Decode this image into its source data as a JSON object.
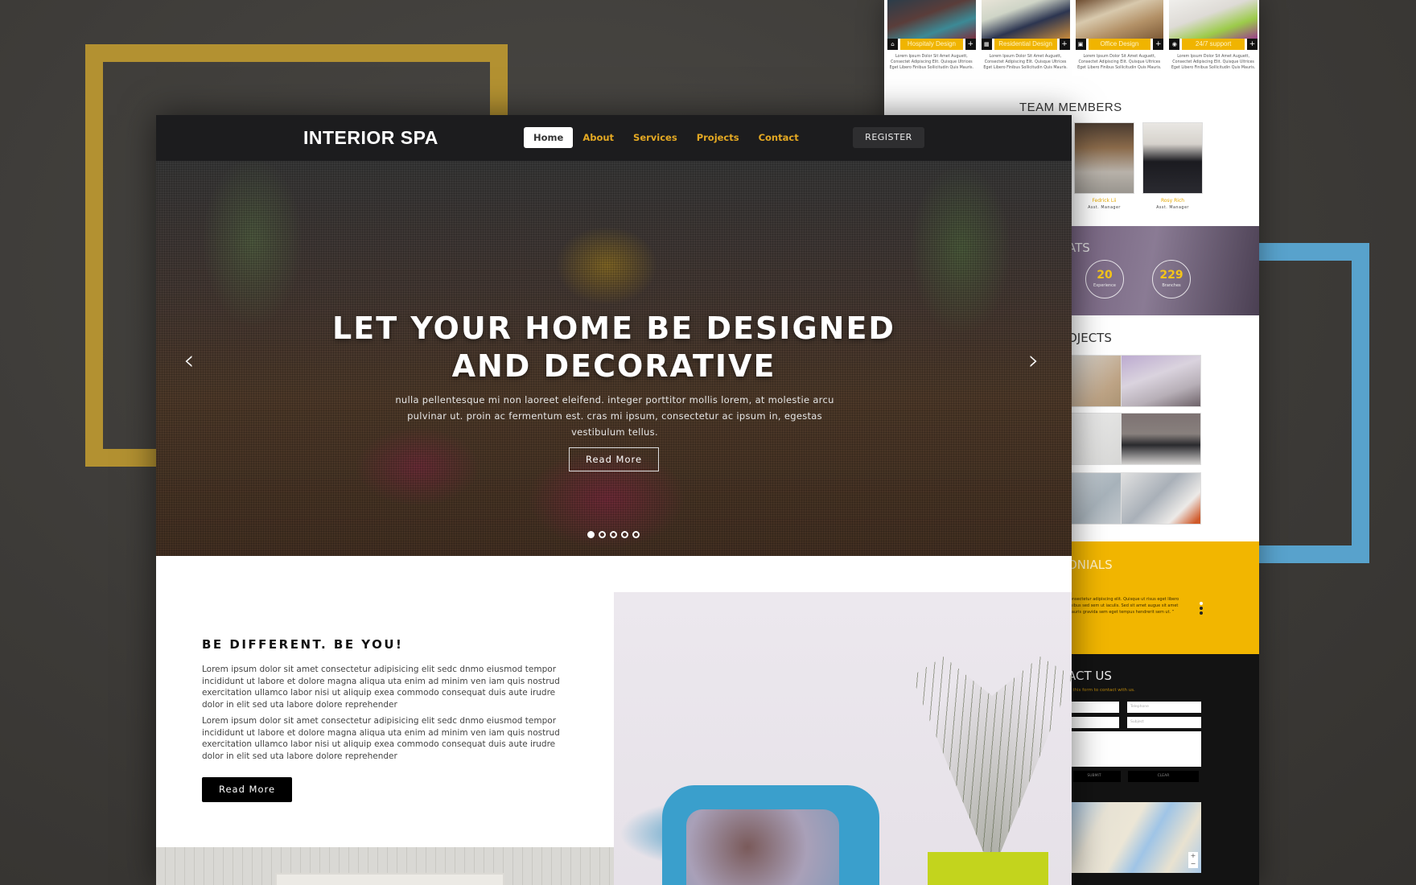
{
  "preview": {
    "services": [
      {
        "icon": "home-icon",
        "label": "Hospitaly Design",
        "text": "Lorem Ipsum Dolor Sit Amet Auguett, Consectet Adipiscing Elit. Quisque Ultrices Eget Libero Finibus Sollicitudin Quis Mauris."
      },
      {
        "icon": "building-icon",
        "label": "Residential Design",
        "text": "Lorem Ipsum Dolor Sit Amet Auguett, Consectet Adipiscing Elit. Quisque Ultrices Eget Libero Finibus Sollicitudin Quis Mauris."
      },
      {
        "icon": "office-icon",
        "label": "Office Design",
        "text": "Lorem Ipsum Dolor Sit Amet Auguett, Consectet Adipiscing Elit. Quisque Ultrices Eget Libero Finibus Sollicitudin Quis Mauris."
      },
      {
        "icon": "support-icon",
        "label": "24/7 support",
        "text": "Lorem Ipsum Dolor Sit Amet Auguett, Consectet Adipiscing Elit. Quisque Ultrices Eget Libero Finibus Sollicitudin Quis Mauris."
      }
    ],
    "plus": "+",
    "team_title": "TEAM MEMBERS",
    "team": [
      {
        "name": "Fedrick Lii",
        "role": "Asst. Manager"
      },
      {
        "name": "Rosy Rich",
        "role": "Asst. Manager"
      }
    ],
    "stats_title": "ATS",
    "stats": [
      {
        "value": "20",
        "label": "Experience"
      },
      {
        "value": "229",
        "label": "Branches"
      }
    ],
    "projects_title": "OJECTS",
    "testimonials_title": "ONIALS",
    "testimonial_text": "consectetur adipiscing elit. Quisque ut risus eget libero finibus sed sem ut iaculis. Sed sit amet augue sit amet mauris gravida sem eget tempus hendrerit sem ut. ”",
    "contact_title": "ACT US",
    "contact_sub": "ill this form to contact with us.",
    "contact_fields": [
      "",
      "Telephone",
      "",
      "Subject",
      ""
    ],
    "submit": "SUBMIT",
    "clear": "CLEAR",
    "map_zoom_in": "+",
    "map_zoom_out": "−"
  },
  "nav": {
    "brand": "INTERIOR SPA",
    "links": [
      "Home",
      "About",
      "Services",
      "Projects",
      "Contact"
    ],
    "active": "Home",
    "register": "REGISTER"
  },
  "hero": {
    "title_line1": "LET YOUR HOME BE DESIGNED",
    "title_line2": "AND DECORATIVE",
    "text": "nulla pellentesque mi non laoreet eleifend. integer porttitor mollis lorem, at molestie arcu pulvinar ut. proin ac fermentum est. cras mi ipsum, consectetur ac ipsum in, egestas vestibulum tellus.",
    "button": "Read More",
    "prev": "‹",
    "next": "›",
    "slides": 5,
    "active_slide": 1
  },
  "about": {
    "title": "BE DIFFERENT. BE YOU!",
    "p1": "Lorem ipsum dolor sit amet consectetur adipisicing elit sedc dnmo eiusmod tempor incididunt ut labore et dolore magna aliqua uta enim ad minim ven iam quis nostrud exercitation ullamco labor nisi ut aliquip exea commodo consequat duis aute irudre dolor in elit sed uta labore dolore reprehender",
    "p2": "Lorem ipsum dolor sit amet consectetur adipisicing elit sedc dnmo eiusmod tempor incididunt ut labore et dolore magna aliqua uta enim ad minim ven iam quis nostrud exercitation ullamco labor nisi ut aliquip exea commodo consequat duis aute irudre dolor in elit sed uta labore dolore reprehender",
    "button": "Read More"
  },
  "colors": {
    "accent": "#f2b600",
    "nav_link": "#e3a823",
    "nav_bg": "#1c1c1e",
    "frame_gold": "#b39131",
    "frame_blue": "#58a2cc"
  }
}
